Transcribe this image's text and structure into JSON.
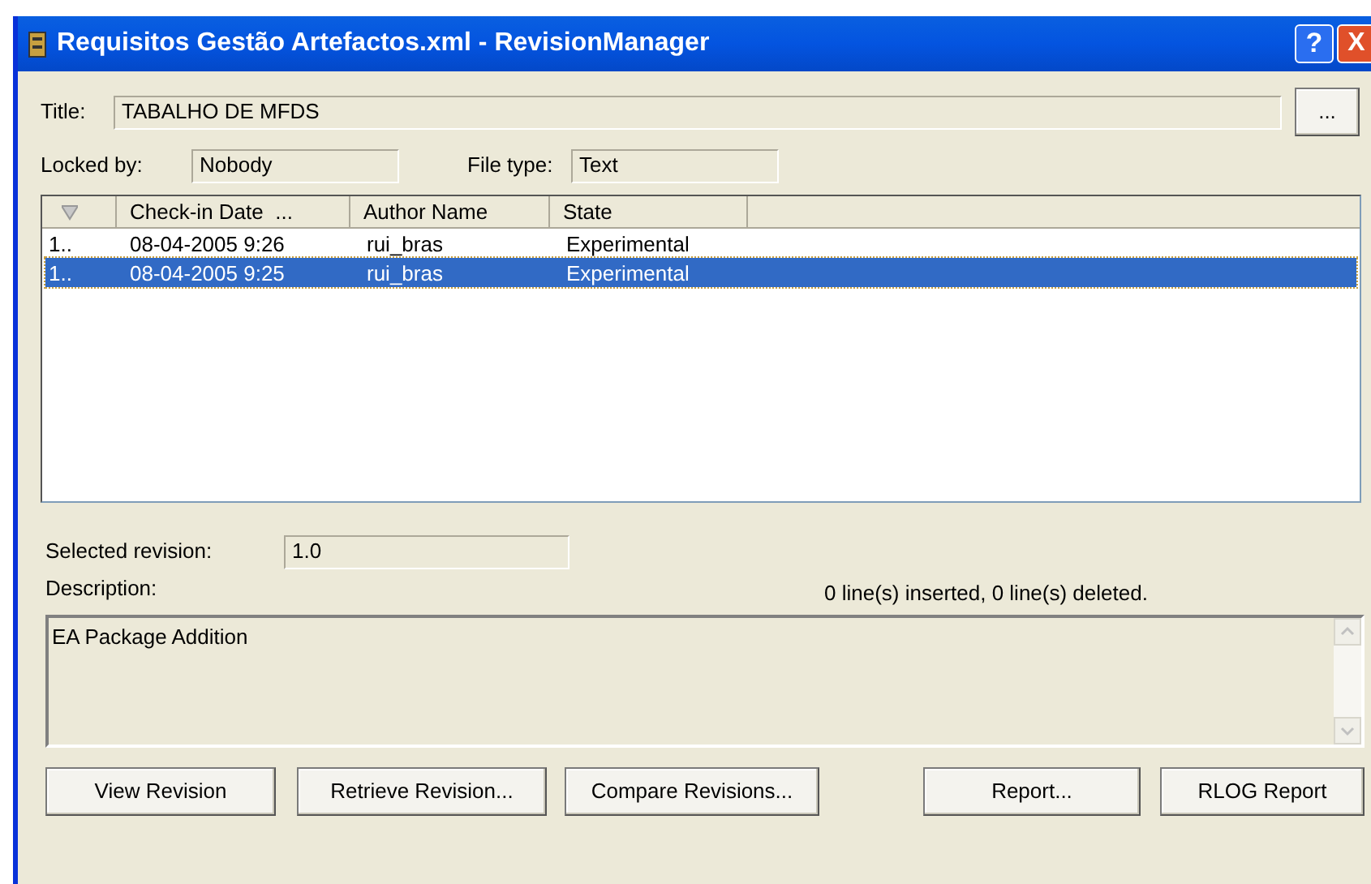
{
  "window": {
    "title": "Requisitos Gestão Artefactos.xml - RevisionManager",
    "help": "?",
    "close": "X"
  },
  "title_field": {
    "label": "Title:",
    "value": "TABALHO DE MFDS",
    "button": "..."
  },
  "locked_by": {
    "label": "Locked by:",
    "value": "Nobody"
  },
  "file_type": {
    "label": "File type:",
    "value": "Text"
  },
  "table": {
    "columns": [
      "Check-in Date  ...",
      "Author Name",
      "State"
    ],
    "rows": [
      {
        "column_1": "1..",
        "date": "08-04-2005 9:26",
        "author": "rui_bras",
        "state": "Experimental",
        "selected": false
      },
      {
        "column_1": "1..",
        "date": "08-04-2005 9:25",
        "author": "rui_bras",
        "state": "Experimental",
        "selected": true
      }
    ]
  },
  "selected_revision": {
    "label": "Selected revision:",
    "value": "1.0"
  },
  "description": {
    "label": "Description:",
    "summary": "0 line(s) inserted, 0 line(s) deleted.",
    "value": "EA Package Addition"
  },
  "buttons": [
    "View Revision",
    "Retrieve Revision...",
    "Compare Revisions...",
    "Report...",
    "RLOG Report"
  ]
}
